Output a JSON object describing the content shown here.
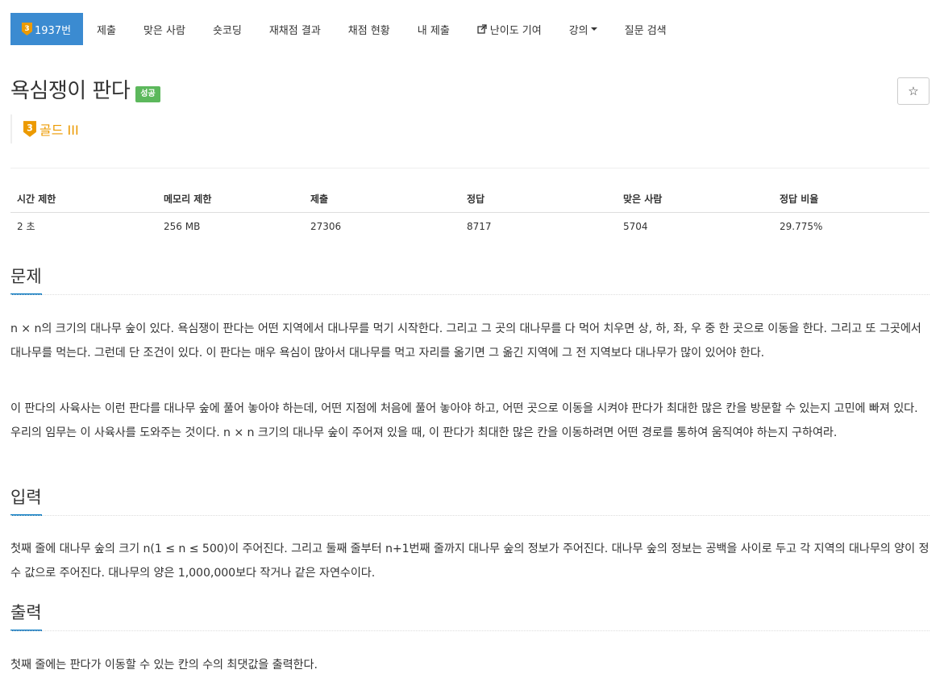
{
  "nav": {
    "problem_number": "1937번",
    "badge_level": "3",
    "submit": "제출",
    "solved_users": "맞은 사람",
    "shortest": "숏코딩",
    "rejudge": "재채점 결과",
    "judge_status": "채점 현황",
    "my_submissions": "내 제출",
    "difficulty": "난이도 기여",
    "lecture": "강의",
    "qna": "질문 검색"
  },
  "problem": {
    "title": "욕심쟁이 판다",
    "status": "성공",
    "tier_level": "3",
    "tier_name": "골드 III",
    "star_icon": "☆"
  },
  "info": {
    "headers": [
      "시간 제한",
      "메모리 제한",
      "제출",
      "정답",
      "맞은 사람",
      "정답 비율"
    ],
    "values": [
      "2 초",
      "256 MB",
      "27306",
      "8717",
      "5704",
      "29.775%"
    ]
  },
  "sections": {
    "description_title": "문제",
    "description_p1": "n × n의 크기의 대나무 숲이 있다. 욕심쟁이 판다는 어떤 지역에서 대나무를 먹기 시작한다. 그리고 그 곳의 대나무를 다 먹어 치우면 상, 하, 좌, 우 중 한 곳으로 이동을 한다. 그리고 또 그곳에서 대나무를 먹는다. 그런데 단 조건이 있다. 이 판다는 매우 욕심이 많아서 대나무를 먹고 자리를 옮기면 그 옮긴 지역에 그 전 지역보다 대나무가 많이 있어야 한다.",
    "description_p2": "이 판다의 사육사는 이런 판다를 대나무 숲에 풀어 놓아야 하는데, 어떤 지점에 처음에 풀어 놓아야 하고, 어떤 곳으로 이동을 시켜야 판다가 최대한 많은 칸을 방문할 수 있는지 고민에 빠져 있다. 우리의 임무는 이 사육사를 도와주는 것이다. n × n 크기의 대나무 숲이 주어져 있을 때, 이 판다가 최대한 많은 칸을 이동하려면 어떤 경로를 통하여 움직여야 하는지 구하여라.",
    "input_title": "입력",
    "input_text": "첫째 줄에 대나무 숲의 크기 n(1 ≤ n ≤ 500)이 주어진다. 그리고 둘째 줄부터 n+1번째 줄까지 대나무 숲의 정보가 주어진다. 대나무 숲의 정보는 공백을 사이로 두고 각 지역의 대나무의 양이 정수 값으로 주어진다. 대나무의 양은 1,000,000보다 작거나 같은 자연수이다.",
    "output_title": "출력",
    "output_text": "첫째 줄에는 판다가 이동할 수 있는 칸의 수의 최댓값을 출력한다."
  },
  "colors": {
    "nav_active": "#3b8bd1",
    "status_success": "#5cb85c",
    "tier_gold": "#ec9a00",
    "section_underline": "#0076c0"
  }
}
